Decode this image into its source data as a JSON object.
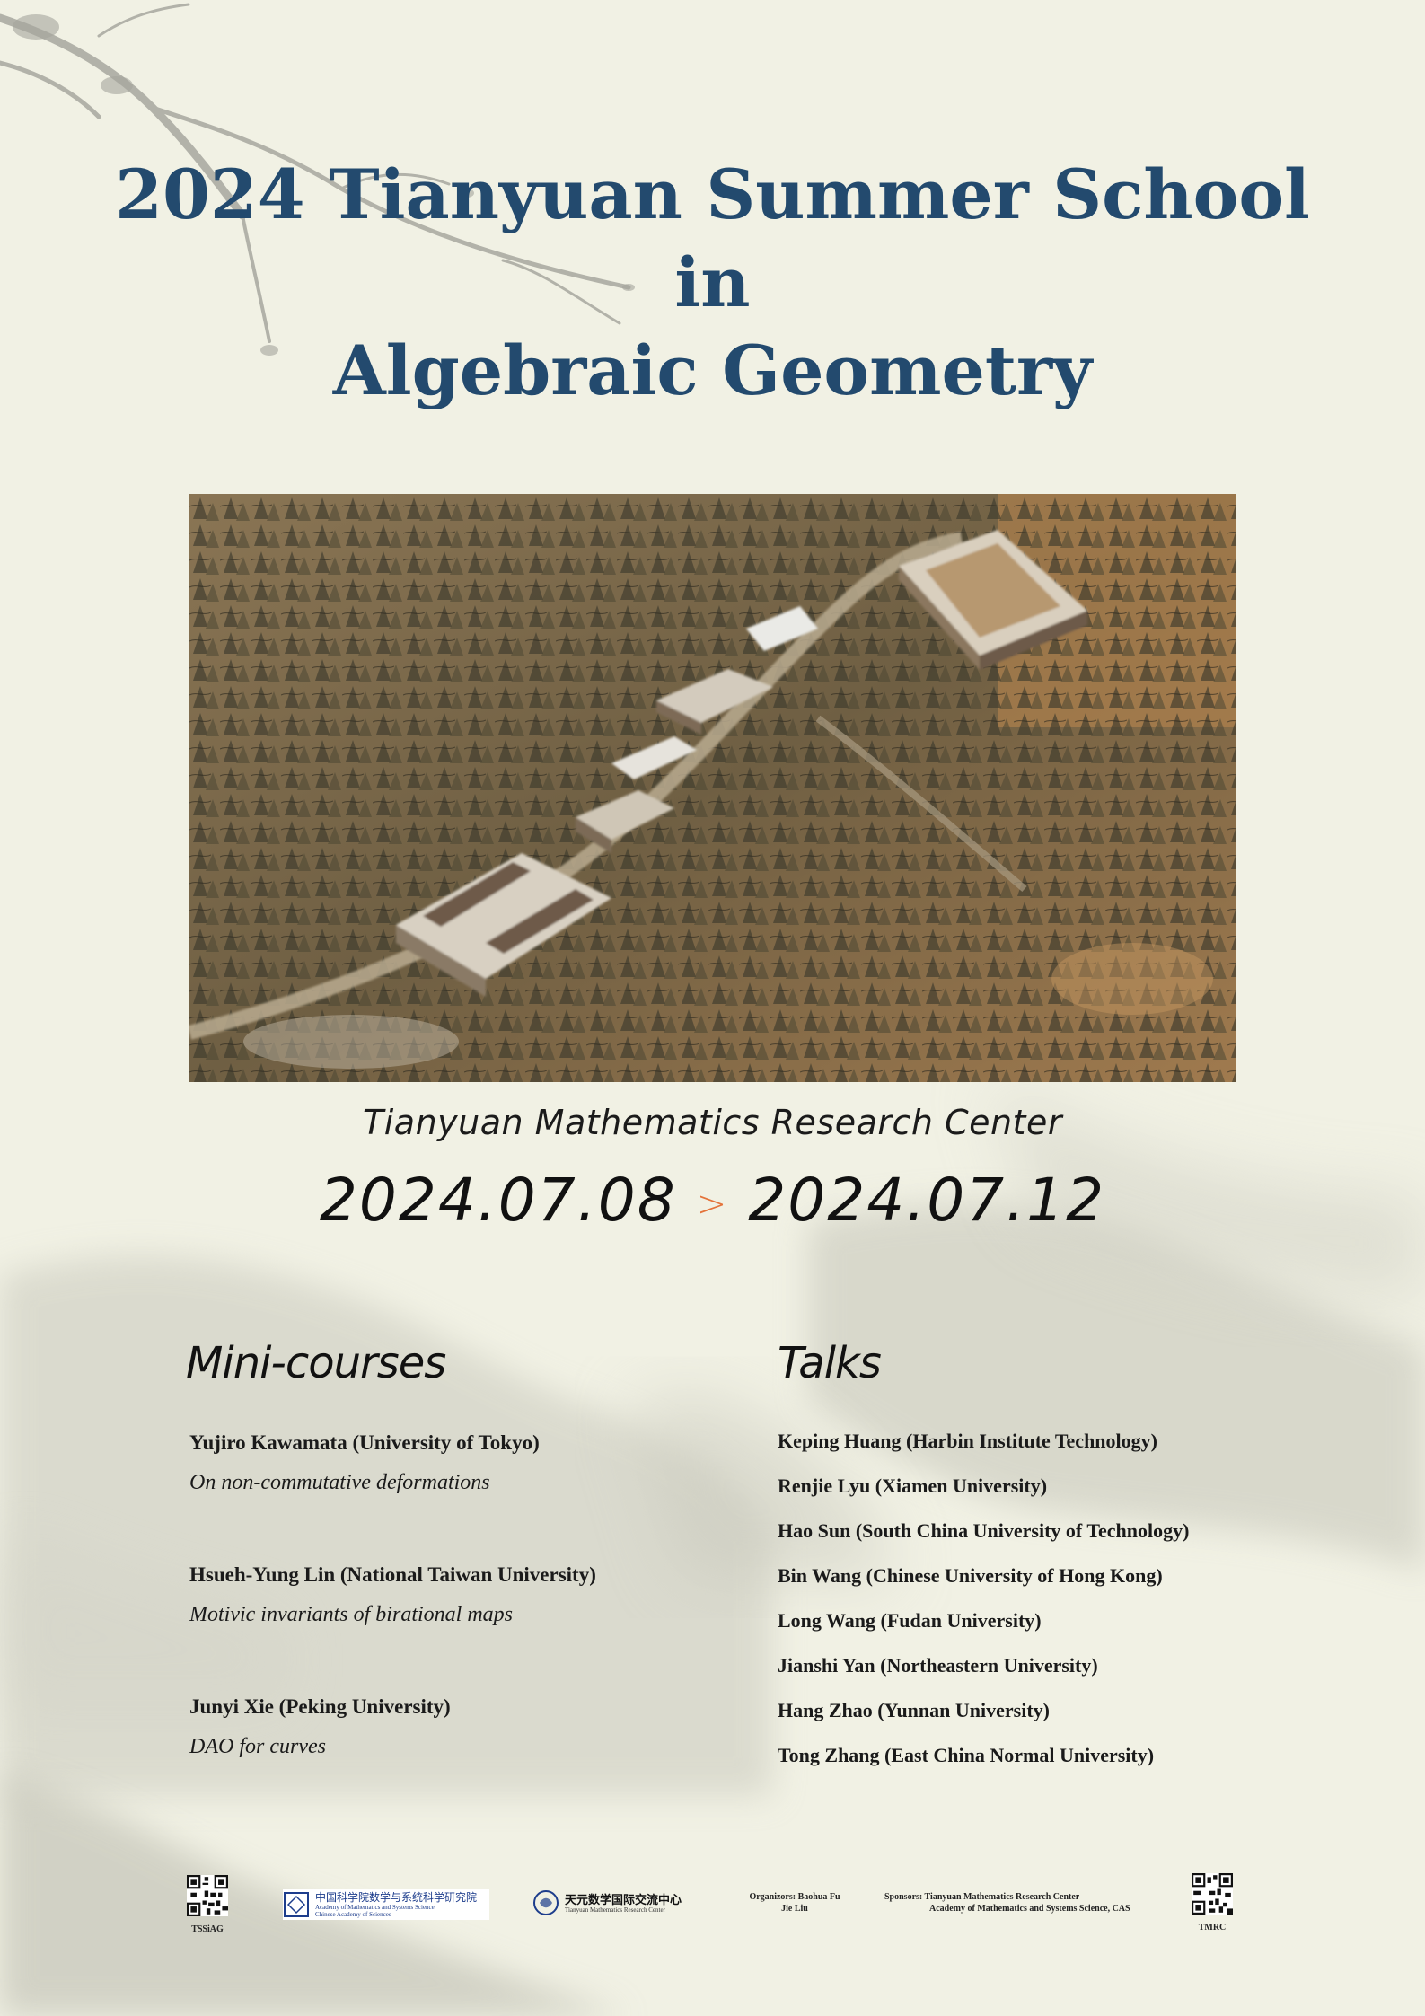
{
  "title": {
    "line1": "2024 Tianyuan Summer School",
    "line2": "in",
    "line3": "Algebraic Geometry"
  },
  "venue": "Tianyuan Mathematics Research Center",
  "dates": {
    "start": "2024.07.08",
    "separator": ">",
    "end": "2024.07.12"
  },
  "mini_courses": {
    "heading": "Mini-courses",
    "items": [
      {
        "speaker": "Yujiro Kawamata (University of Tokyo)",
        "topic": "On non-commutative deformations"
      },
      {
        "speaker": "Hsueh-Yung Lin (National Taiwan University)",
        "topic": "Motivic invariants of birational maps"
      },
      {
        "speaker": "Junyi Xie (Peking University)",
        "topic": "DAO for curves"
      }
    ]
  },
  "talks": {
    "heading": "Talks",
    "items": [
      "Keping Huang (Harbin Institute Technology)",
      "Renjie Lyu (Xiamen University)",
      "Hao Sun (South China University of Technology)",
      "Bin Wang (Chinese University of Hong Kong)",
      "Long Wang (Fudan University)",
      "Jianshi Yan (Northeastern University)",
      "Hang Zhao (Yunnan University)",
      "Tong Zhang (East China Normal University)"
    ]
  },
  "footer": {
    "qr_left_label": "TSSiAG",
    "amss_logo_cn": "中国科学院数学与系统科学研究院",
    "amss_logo_en1": "Academy of Mathematics and Systems Science",
    "amss_logo_en2": "Chinese Academy of Sciences",
    "tianyuan_logo_cn": "天元数学国际交流中心",
    "tianyuan_logo_en": "Tianyuan Mathematics Research Center",
    "organizers_line1": "Organizors: Baohua Fu",
    "organizers_line2": "Jie Liu",
    "sponsors_line1": "Sponsors: Tianyuan Mathematics Research Center",
    "sponsors_line2": "Academy of Mathematics and Systems Science, CAS",
    "qr_right_label": "TMRC"
  },
  "colors": {
    "title": "#234a6e",
    "background": "#f1f1e4",
    "accent_arrow": "#e4733a"
  }
}
